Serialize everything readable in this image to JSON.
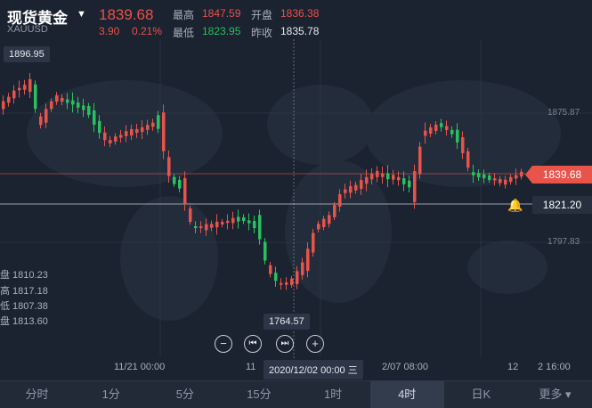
{
  "header": {
    "title": "现货黄金",
    "symbol": "XAUUSD",
    "price": "1839.68",
    "change": "3.90",
    "change_pct": "0.21%",
    "high_label": "最高",
    "high": "1847.59",
    "open_label": "开盘",
    "open": "1836.38",
    "low_label": "最低",
    "low": "1823.95",
    "prev_close_label": "昨收",
    "prev_close": "1835.78"
  },
  "chart": {
    "max_tag": "1896.95",
    "min_tag": "1764.57",
    "y_labels": [
      "1875.87",
      "1797.83"
    ],
    "current_price_tag": "1839.68",
    "alert_price_tag": "1821.20",
    "ohlc": {
      "open": "盘 1810.23",
      "high": "高 1817.18",
      "low": "低 1807.38",
      "close": "盘 1813.60"
    },
    "x_labels": [
      "11/21 00:00",
      "11",
      "2/07 08:00",
      "12",
      "2 16:00"
    ],
    "crosshair_time": "2020/12/02 00:00 三",
    "colors": {
      "up": "#e8534a",
      "down": "#28c15f",
      "background": "#1b2230"
    }
  },
  "controls": [
    "minus-icon",
    "skip-back-icon",
    "skip-forward-icon",
    "plus-icon"
  ],
  "periods": [
    {
      "label": "分时"
    },
    {
      "label": "1分"
    },
    {
      "label": "5分"
    },
    {
      "label": "15分"
    },
    {
      "label": "1时"
    },
    {
      "label": "4时",
      "active": true
    },
    {
      "label": "日K"
    },
    {
      "label": "更多"
    }
  ]
}
